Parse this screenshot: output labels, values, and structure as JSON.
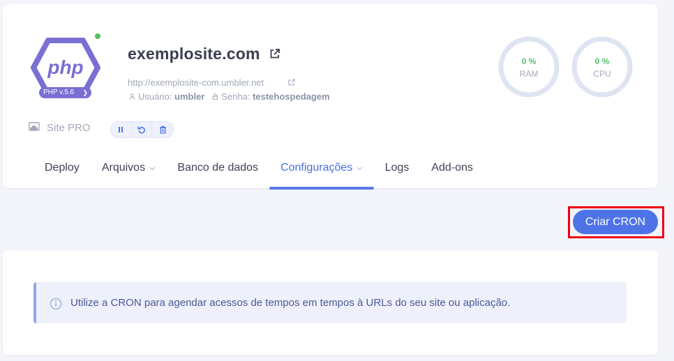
{
  "site": {
    "title": "exemplosite.com",
    "url": "http://exemplosite-com.umbler.net",
    "user_label": "Usuário:",
    "user_value": "umbler",
    "password_label": "Senha:",
    "password_value": "testehospedagem",
    "php_version": "PHP v.5.6",
    "plan": "Site PRO",
    "status_color": "#4fc35a"
  },
  "controls": {
    "pause_icon": "pause-icon",
    "restart_icon": "restart-icon",
    "delete_icon": "trash-icon"
  },
  "gauges": {
    "ram": {
      "value": "0 %",
      "label": "RAM"
    },
    "cpu": {
      "value": "0 %",
      "label": "CPU"
    }
  },
  "tabs": [
    {
      "label": "Deploy"
    },
    {
      "label": "Arquivos"
    },
    {
      "label": "Banco de dados"
    },
    {
      "label": "Configurações"
    },
    {
      "label": "Logs"
    },
    {
      "label": "Add-ons"
    }
  ],
  "active_tab": "Configurações",
  "cron": {
    "button_label": "Criar CRON",
    "info_text": "Utilize a CRON para agendar acessos de tempos em tempos à URLs do seu site ou aplicação."
  },
  "colors": {
    "accent": "#4e73e6",
    "highlight": "#f00014",
    "php_purple": "#7a6fd2"
  }
}
